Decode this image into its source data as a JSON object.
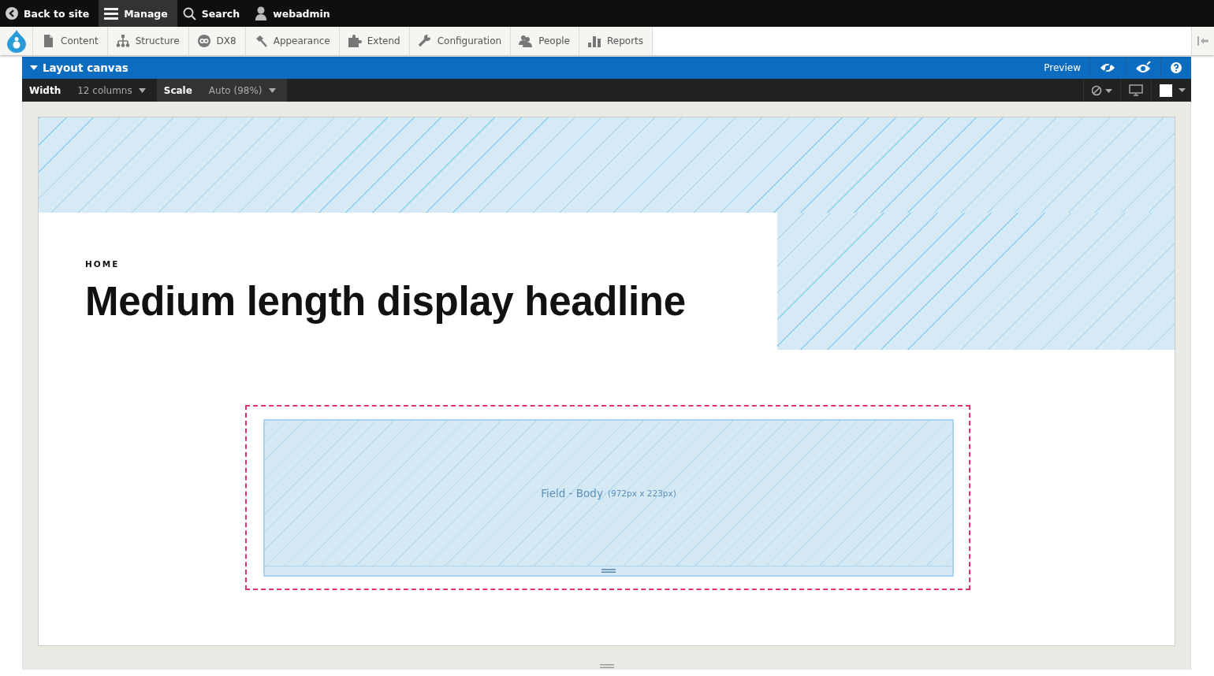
{
  "toolbar": {
    "items": [
      {
        "kind": "back",
        "label": "Back to site",
        "selected": false
      },
      {
        "kind": "manage",
        "label": "Manage",
        "selected": true
      },
      {
        "kind": "search",
        "label": "Search",
        "selected": false
      },
      {
        "kind": "user",
        "label": "webadmin",
        "selected": false
      }
    ]
  },
  "tray": {
    "items": [
      {
        "kind": "content",
        "label": "Content"
      },
      {
        "kind": "structure",
        "label": "Structure"
      },
      {
        "kind": "dx8",
        "label": "DX8"
      },
      {
        "kind": "appearance",
        "label": "Appearance"
      },
      {
        "kind": "extend",
        "label": "Extend"
      },
      {
        "kind": "configuration",
        "label": "Configuration"
      },
      {
        "kind": "people",
        "label": "People"
      },
      {
        "kind": "reports",
        "label": "Reports"
      }
    ]
  },
  "canvas_bar": {
    "title": "Layout canvas",
    "expanded": true,
    "preview": "Preview"
  },
  "controls": [
    {
      "label": "Width",
      "value": "12 columns"
    },
    {
      "label": "Scale",
      "value": "Auto (98%)"
    }
  ],
  "page": {
    "breadcrumb": "HOME",
    "headline": "Medium length display headline",
    "component": {
      "name": "Field - Body",
      "size": "(972px x 223px)",
      "selected": true
    }
  }
}
